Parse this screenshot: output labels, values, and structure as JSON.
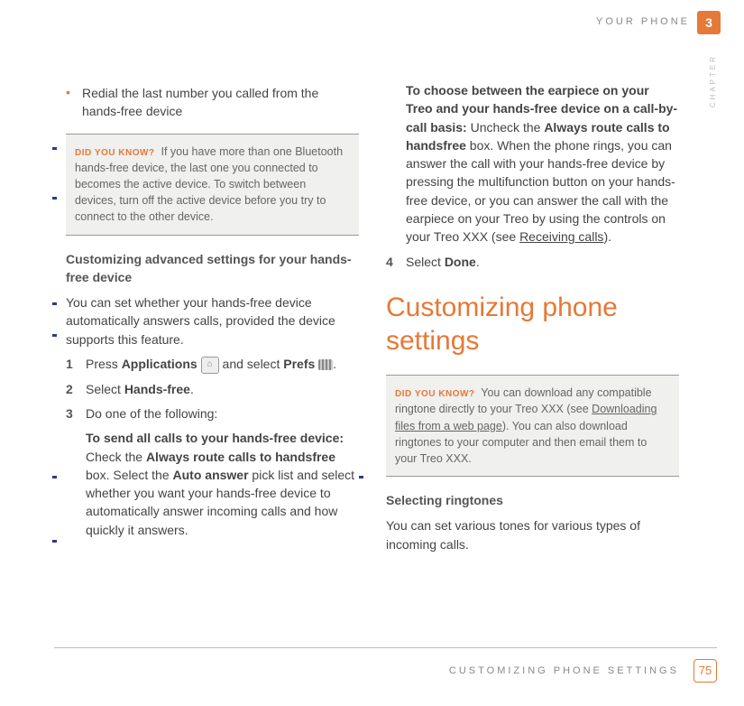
{
  "header": {
    "text": "YOUR PHONE",
    "chapter_number": "3",
    "chapter_label": "CHAPTER"
  },
  "left": {
    "bullet": "Redial the last number you called from the hands-free device",
    "tip": {
      "label": "DID YOU KNOW?",
      "text": "If you have more than one Bluetooth hands-free device, the last one you connected to becomes the active device. To switch between devices, turn off the active device before you try to connect to the other device."
    },
    "subhead": "Customizing advanced settings for your hands-free device",
    "intro": "You can set whether your hands-free device automatically answers calls, provided the device supports this feature.",
    "step1_a": "Press ",
    "step1_b": "Applications",
    "step1_c": " and select ",
    "step1_d": "Prefs",
    "step1_e": ".",
    "step2_a": "Select ",
    "step2_b": "Hands-free",
    "step2_c": ".",
    "step3": "Do one of the following:",
    "send_a": "To send all calls to your hands-free device:",
    "send_b": " Check the ",
    "send_c": "Always route calls to handsfree",
    "send_d": " box. Select the ",
    "send_e": "Auto answer",
    "send_f": " pick list and select whether you want your hands-free device to automatically answer incoming calls and how quickly it answers."
  },
  "right": {
    "choose_a": "To choose between the earpiece on your Treo and your hands-free device on a call-by-call basis:",
    "choose_b": " Uncheck the ",
    "choose_c": "Always route calls to handsfree",
    "choose_d": " box. When the phone rings, you can answer the call with your hands-free device by pressing the multifunction button on your hands-free device, or you can answer the call with the earpiece on your Treo by using the controls on your Treo XXX (see ",
    "choose_e": "Receiving calls",
    "choose_f": ").",
    "step4_a": "Select ",
    "step4_b": "Done",
    "step4_c": ".",
    "big": "Customizing phone settings",
    "tip": {
      "label": "DID YOU KNOW?",
      "t1": "You can download any compatible ringtone directly to your Treo XXX (see ",
      "t2": "Downloading files from a web page",
      "t3": "). You can also download ringtones to your computer and then email them to your Treo XXX."
    },
    "sub2": "Selecting ringtones",
    "ring": "You can set various tones for various types of incoming calls."
  },
  "footer": {
    "text": "CUSTOMIZING PHONE SETTINGS",
    "page": "75"
  },
  "icons": {
    "home": "⌂"
  }
}
